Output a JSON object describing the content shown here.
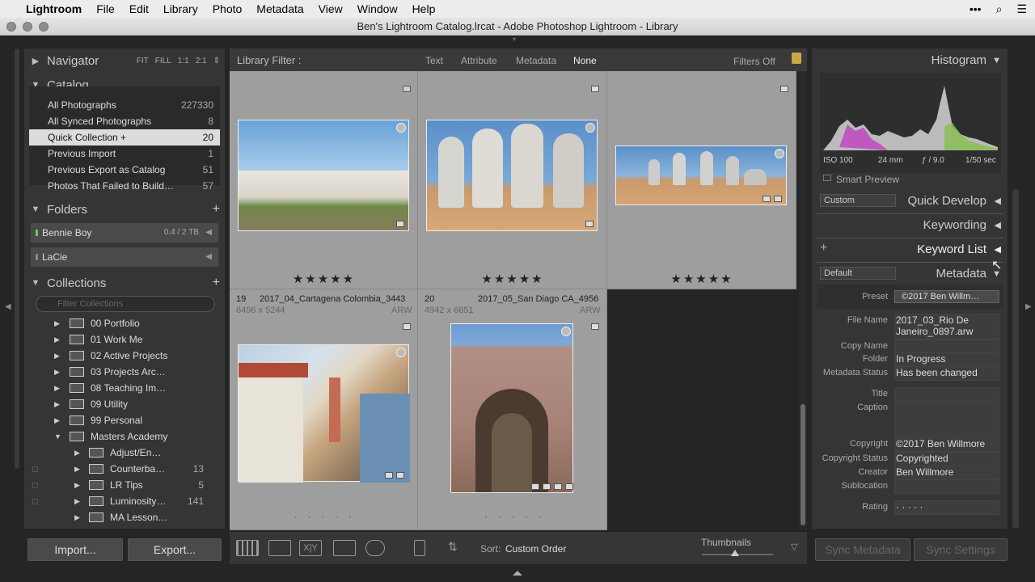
{
  "menubar": {
    "app": "Lightroom",
    "items": [
      "File",
      "Edit",
      "Library",
      "Photo",
      "Metadata",
      "View",
      "Window",
      "Help"
    ]
  },
  "window": {
    "title": "Ben's Lightroom Catalog.lrcat - Adobe Photoshop Lightroom - Library"
  },
  "left": {
    "navigator": {
      "title": "Navigator",
      "opts": [
        "FIT",
        "FILL",
        "1:1",
        "2:1"
      ]
    },
    "catalog": {
      "title": "Catalog",
      "items": [
        {
          "label": "All Photographs",
          "count": "227330"
        },
        {
          "label": "All Synced Photographs",
          "count": "8"
        },
        {
          "label": "Quick Collection  +",
          "count": "20"
        },
        {
          "label": "Previous Import",
          "count": "1"
        },
        {
          "label": "Previous Export as Catalog",
          "count": "51"
        },
        {
          "label": "Photos That Failed to Build…",
          "count": "57"
        }
      ]
    },
    "folders": {
      "title": "Folders",
      "items": [
        {
          "label": "Bennie Boy",
          "size": "0.4 / 2 TB"
        },
        {
          "label": "LaCie",
          "size": ""
        }
      ]
    },
    "collections": {
      "title": "Collections",
      "search_placeholder": "Filter Collections",
      "items": [
        {
          "label": "00 Portfolio",
          "count": ""
        },
        {
          "label": "01 Work Me",
          "count": ""
        },
        {
          "label": "02 Active Projects",
          "count": ""
        },
        {
          "label": "03 Projects Arc…",
          "count": ""
        },
        {
          "label": "08 Teaching Im…",
          "count": ""
        },
        {
          "label": "09 Utility",
          "count": ""
        },
        {
          "label": "99 Personal",
          "count": ""
        },
        {
          "label": "Masters Academy",
          "count": ""
        },
        {
          "label": "Adjust/En…",
          "count": ""
        },
        {
          "label": "Counterba…",
          "count": "13"
        },
        {
          "label": "LR Tips",
          "count": "5"
        },
        {
          "label": "Luminosity…",
          "count": "141"
        },
        {
          "label": "MA Lesson…",
          "count": ""
        }
      ]
    },
    "import_label": "Import...",
    "export_label": "Export..."
  },
  "filter": {
    "title": "Library Filter :",
    "options": [
      "Text",
      "Attribute",
      "Metadata",
      "None"
    ],
    "status": "Filters Off"
  },
  "grid": {
    "cells": [
      {
        "index": "19",
        "name": "2017_04_Cartagena Colombia_3443",
        "dims": "6496 x 5244",
        "type": "ARW"
      },
      {
        "index": "20",
        "name": "2017_05_San Diago CA_4956",
        "dims": "4942 x 6851",
        "type": "ARW"
      }
    ],
    "stars": "★★★★★",
    "dots": "· · · · ·"
  },
  "toolbar": {
    "sort_label": "Sort:",
    "sort_value": "Custom Order",
    "thumbnails_label": "Thumbnails"
  },
  "right": {
    "histogram": {
      "title": "Histogram",
      "iso": "ISO 100",
      "focal": "24 mm",
      "aperture": "ƒ / 9.0",
      "shutter": "1/50 sec",
      "smart_preview": "Smart Preview"
    },
    "quick_develop": {
      "title": "Quick Develop",
      "preset": "Custom"
    },
    "keywording": {
      "title": "Keywording"
    },
    "keyword_list": {
      "title": "Keyword List"
    },
    "metadata": {
      "title": "Metadata",
      "view": "Default",
      "preset_label": "Preset",
      "preset_value": "©2017 Ben Willm…",
      "fields": [
        {
          "label": "File Name",
          "value": "2017_03_Rio De Janeiro_0897.arw"
        },
        {
          "label": "Copy Name",
          "value": ""
        },
        {
          "label": "Folder",
          "value": "In Progress"
        },
        {
          "label": "Metadata Status",
          "value": "Has been changed"
        },
        {
          "label": "Title",
          "value": ""
        },
        {
          "label": "Caption",
          "value": ""
        },
        {
          "label": "Copyright",
          "value": "©2017 Ben Willmore"
        },
        {
          "label": "Copyright Status",
          "value": "Copyrighted"
        },
        {
          "label": "Creator",
          "value": "Ben Willmore"
        },
        {
          "label": "Sublocation",
          "value": ""
        },
        {
          "label": "Rating",
          "value": "· · · · ·"
        }
      ]
    },
    "sync_metadata": "Sync Metadata",
    "sync_settings": "Sync Settings"
  },
  "colors": {
    "panel": "#353535",
    "grid_cell": "#9e9e9e",
    "selected_row": "#dcdcdc"
  }
}
